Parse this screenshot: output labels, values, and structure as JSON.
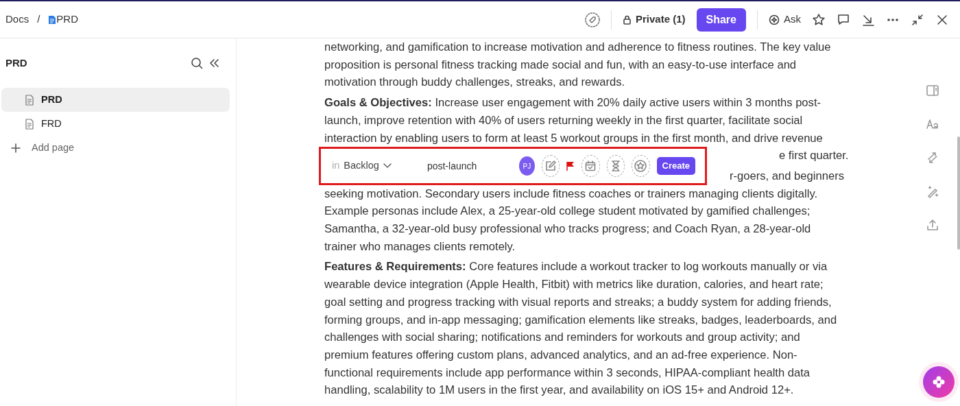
{
  "breadcrumb": [
    {
      "label": "Docs",
      "doc_icon": false
    },
    {
      "label": "PRD",
      "doc_icon": true
    }
  ],
  "breadcrumb_separator": "/",
  "toolbar": {
    "privacy": "Private (1)",
    "share": "Share",
    "ask": "Ask"
  },
  "sidebar": {
    "title": "PRD",
    "pages": [
      {
        "label": "PRD",
        "selected": true
      },
      {
        "label": "FRD",
        "selected": false
      }
    ],
    "add_page": "Add page"
  },
  "document": [
    {
      "lines": [
        "networking, and gamification to increase motivation and adherence to fitness routines. The key value",
        "proposition is personal fitness tracking made social and fun, with an easy-to-use interface and",
        "motivation through buddy challenges, streaks, and rewards."
      ]
    },
    {
      "lines": [
        "**Goals & Objectives:** Increase user engagement with 20% daily active users within 3 months post-",
        "launch, improve retention with 40% of users returning weekly in the first quarter, facilitate social",
        "interaction by enabling users to form at least 5 workout groups in the first month, and drive revenue"
      ],
      "covered_tail": [
        "e first quarter."
      ]
    },
    {
      "covered_tail": [
        "r-goers, and beginners"
      ],
      "lines": [
        "seeking motivation. Secondary users include fitness coaches or trainers managing clients digitally.",
        "Example personas include Alex, a 25-year-old college student motivated by gamified challenges;",
        "Samantha, a 32-year-old busy professional who tracks progress; and Coach Ryan, a 28-year-old",
        "trainer who manages clients remotely."
      ]
    },
    {
      "lines": [
        "**Features & Requirements:** Core features include a workout tracker to log workouts manually or via",
        "wearable device integration (Apple Health, Fitbit) with metrics like duration, calories, and heart rate;",
        "goal setting and progress tracking with visual reports and streaks; a buddy system for adding friends,",
        "forming groups, and in-app messaging; gamification elements like streaks, badges, leaderboards, and",
        "challenges with social sharing; notifications and reminders for workouts and group activity; and",
        "premium features offering custom plans, advanced analytics, and an ad-free experience. Non-",
        "functional requirements include app performance within 3 seconds, HIPAA-compliant health data",
        "handling, scalability to 1M users in the first year, and availability on iOS 15+ and Android 12+."
      ]
    }
  ],
  "task_popup": {
    "prefix": "in",
    "list": "Backlog",
    "title": "post-launch",
    "assignee": "PJ",
    "create": "Create"
  }
}
